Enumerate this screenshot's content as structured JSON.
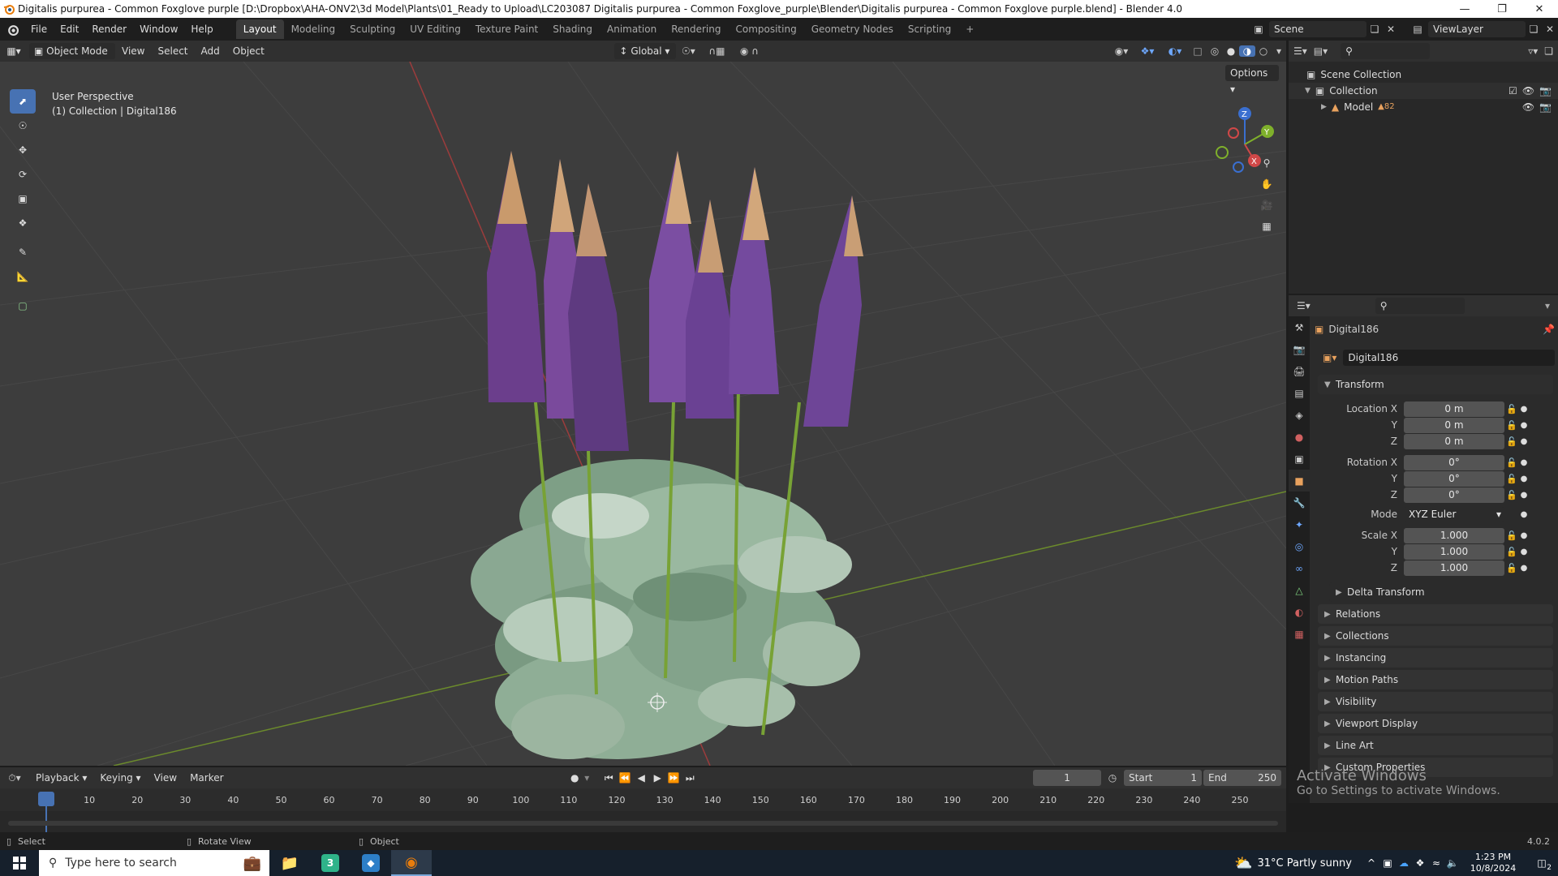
{
  "window": {
    "title": "Digitalis purpurea - Common Foxglove purple [D:\\Dropbox\\AHA-ONV2\\3d Model\\Plants\\01_Ready to Upload\\LC203087 Digitalis purpurea - Common Foxglove_purple\\Blender\\Digitalis purpurea - Common Foxglove purple.blend] - Blender 4.0"
  },
  "menu": [
    "File",
    "Edit",
    "Render",
    "Window",
    "Help"
  ],
  "workspaces": [
    {
      "label": "Layout",
      "active": true
    },
    {
      "label": "Modeling"
    },
    {
      "label": "Sculpting"
    },
    {
      "label": "UV Editing"
    },
    {
      "label": "Texture Paint"
    },
    {
      "label": "Shading"
    },
    {
      "label": "Animation"
    },
    {
      "label": "Rendering"
    },
    {
      "label": "Compositing"
    },
    {
      "label": "Geometry Nodes"
    },
    {
      "label": "Scripting"
    }
  ],
  "add_workspace": "+",
  "scene": {
    "name": "Scene",
    "view_layer": "ViewLayer"
  },
  "viewport_header": {
    "mode": "Object Mode",
    "menus": [
      "View",
      "Select",
      "Add",
      "Object"
    ],
    "orientation": "Global",
    "options": "Options"
  },
  "viewport": {
    "perspective": "User Perspective",
    "collection_info": "(1) Collection | Digital186",
    "axis": {
      "x": "X",
      "y": "Y",
      "z": "Z"
    }
  },
  "outliner": {
    "root": "Scene Collection",
    "collection": "Collection",
    "item": "Model",
    "badge": "82"
  },
  "properties": {
    "object_name": "Digital186",
    "data_name": "Digital186",
    "section": "Transform",
    "location": {
      "label": "Location X",
      "x": "0 m",
      "y": "0 m",
      "z": "0 m"
    },
    "rotation": {
      "label": "Rotation X",
      "x": "0°",
      "y": "0°",
      "z": "0°"
    },
    "mode": {
      "label": "Mode",
      "value": "XYZ Euler"
    },
    "scale": {
      "label": "Scale X",
      "x": "1.000",
      "y": "1.000",
      "z": "1.000"
    },
    "axis_labels": {
      "y": "Y",
      "z": "Z"
    },
    "subsection": "Delta Transform",
    "panels": [
      "Relations",
      "Collections",
      "Instancing",
      "Motion Paths",
      "Visibility",
      "Viewport Display",
      "Line Art",
      "Custom Properties"
    ]
  },
  "timeline": {
    "menus": [
      "Playback",
      "Keying",
      "View",
      "Marker"
    ],
    "current_frame": "1",
    "start_label": "Start",
    "start": "1",
    "end_label": "End",
    "end": "250",
    "ticks": [
      "1",
      "10",
      "20",
      "30",
      "40",
      "50",
      "60",
      "70",
      "80",
      "90",
      "100",
      "110",
      "120",
      "130",
      "140",
      "150",
      "160",
      "170",
      "180",
      "190",
      "200",
      "210",
      "220",
      "230",
      "240",
      "250"
    ]
  },
  "activation": {
    "title": "Activate Windows",
    "subtitle": "Go to Settings to activate Windows."
  },
  "status": {
    "select": "Select",
    "rotate": "Rotate View",
    "object": "Object",
    "version": "4.0.2"
  },
  "taskbar": {
    "search_placeholder": "Type here to search",
    "weather": "31°C  Partly sunny",
    "time": "1:23 PM",
    "date": "10/8/2024",
    "notif_count": "2",
    "app3": "3"
  }
}
